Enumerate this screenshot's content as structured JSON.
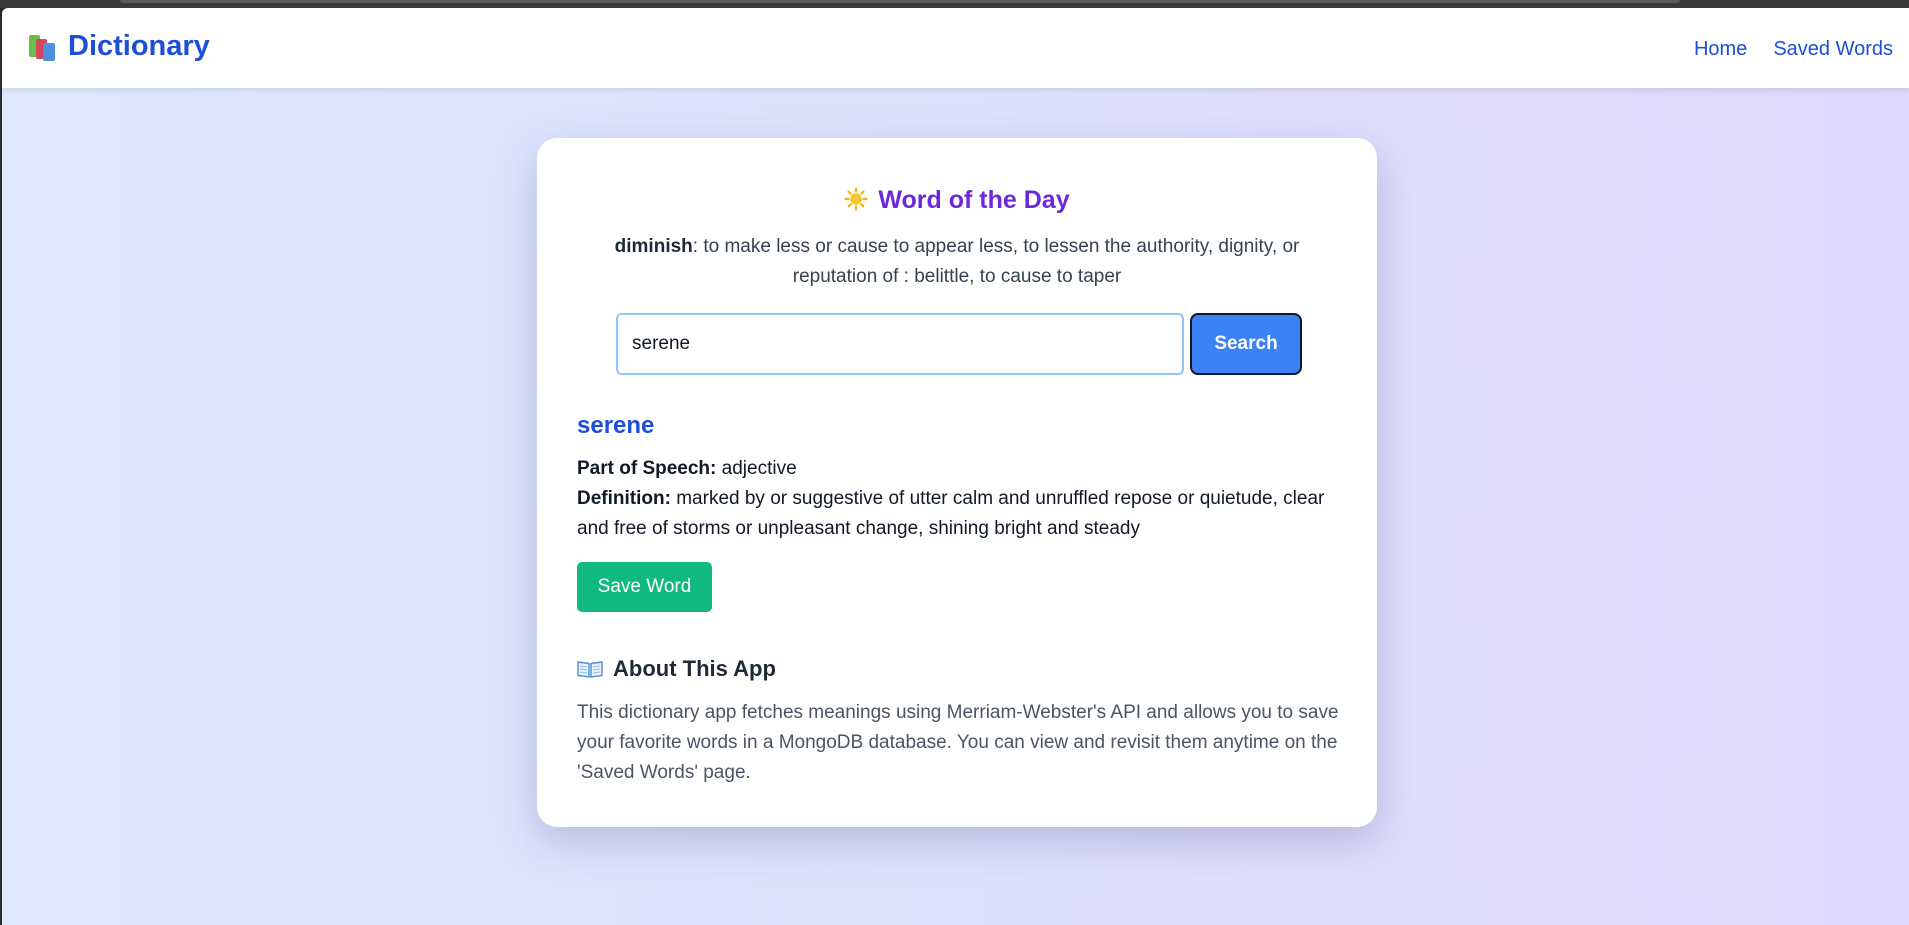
{
  "navbar": {
    "brand": "Dictionary",
    "links": [
      {
        "label": "Home"
      },
      {
        "label": "Saved Words"
      }
    ]
  },
  "word_of_the_day": {
    "icon": "sun-icon",
    "title": "Word of the Day",
    "word": "diminish",
    "definition": ": to make less or cause to appear less, to lessen the authority, dignity, or reputation of : belittle, to cause to taper"
  },
  "search": {
    "value": "serene",
    "button_label": "Search"
  },
  "result": {
    "word": "serene",
    "part_of_speech_label": "Part of Speech:",
    "part_of_speech": "adjective",
    "definition_label": "Definition:",
    "definition": "marked by or suggestive of utter calm and unruffled repose or quietude, clear and free of storms or unpleasant change, shining bright and steady",
    "save_label": "Save Word"
  },
  "about": {
    "icon": "open-book-icon",
    "title": "About This App",
    "text": "This dictionary app fetches meanings using Merriam-Webster's API and allows you to save your favorite words in a MongoDB database. You can view and revisit them anytime on the 'Saved Words' page."
  },
  "colors": {
    "brand": "#1d4ed8",
    "accent_purple": "#6d28d9",
    "search_button": "#3b82f6",
    "save_button": "#10b981"
  }
}
